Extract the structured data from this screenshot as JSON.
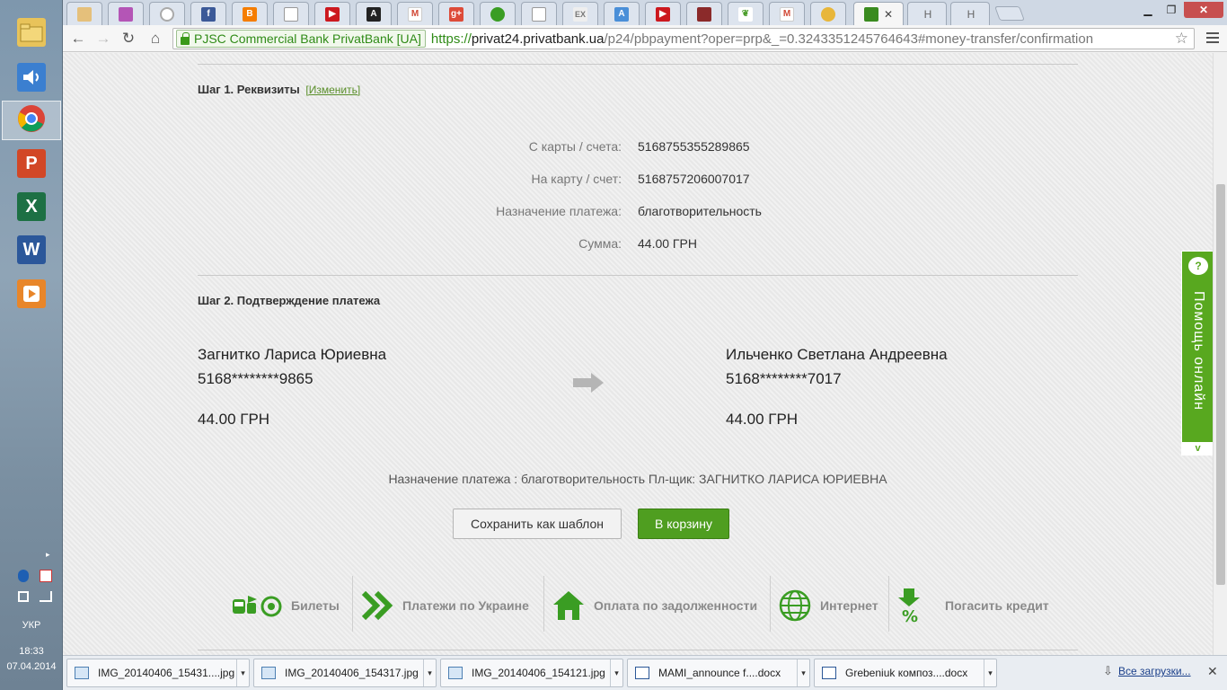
{
  "taskbar": {
    "apps": [
      {
        "name": "file-explorer-icon",
        "label": ""
      },
      {
        "name": "volume-icon",
        "label": ""
      },
      {
        "name": "chrome-icon",
        "label": ""
      },
      {
        "name": "powerpoint-icon",
        "label": "P"
      },
      {
        "name": "excel-icon",
        "label": "X"
      },
      {
        "name": "word-icon",
        "label": "W"
      },
      {
        "name": "media-player-icon",
        "label": ""
      }
    ],
    "language": "УКР",
    "time": "18:33",
    "date": "07.04.2014"
  },
  "browser": {
    "tabs": [
      "",
      "",
      "",
      "",
      "",
      "",
      "",
      "",
      "",
      "",
      "",
      "",
      "",
      "",
      "",
      "",
      "",
      "",
      "",
      "",
      "",
      "",
      "Н",
      "Н"
    ],
    "active_tab_close": "✕",
    "ev_label": "PJSC Commercial Bank PrivatBank [UA]",
    "url": {
      "proto": "https://",
      "host": "privat24.privatbank.ua",
      "path": "/p24/pbpayment?oper=prp&_=0.3243351245764643#money-transfer/confirmation"
    }
  },
  "step1": {
    "title": "Шаг 1. Реквизиты",
    "edit_link": "[Изменить]",
    "rows": [
      {
        "label": "С карты / счета:",
        "value": "5168755355289865"
      },
      {
        "label": "На карту / счет:",
        "value": "5168757206007017"
      },
      {
        "label": "Назначение платежа:",
        "value": "благотворительность"
      },
      {
        "label": "Сумма:",
        "value": "44.00 ГРН"
      }
    ]
  },
  "step2": {
    "title": "Шаг 2. Подтверждение платежа",
    "sender": {
      "name": "Загнитко Лариса Юриевна",
      "card": "5168********9865",
      "amount": "44.00 ГРН"
    },
    "recipient": {
      "name": "Ильченко Светлана Андреевна",
      "card": "5168********7017",
      "amount": "44.00 ГРН"
    },
    "purpose": "Назначение платежа : благотворительность Пл-щик: ЗАГНИТКО ЛАРИСА ЮРИЕВНА",
    "save_template_label": "Сохранить как шаблон",
    "cart_label": "В корзину"
  },
  "services": [
    {
      "name": "tickets",
      "label": "Билеты"
    },
    {
      "name": "ukraine-payments",
      "label": "Платежи по Украине"
    },
    {
      "name": "debt-payment",
      "label": "Оплата по задолженности"
    },
    {
      "name": "internet",
      "label": "Интернет"
    },
    {
      "name": "repay-credit",
      "label": "Погасить кредит"
    }
  ],
  "help_widget": {
    "label": "Помощь онлайн",
    "close": "v"
  },
  "downloads": {
    "items": [
      "IMG_20140406_15431....jpg",
      "IMG_20140406_154317.jpg",
      "IMG_20140406_154121.jpg",
      "MAMI_announce f....docx",
      "Grebeniuk композ....docx"
    ],
    "show_all": "Все загрузки...",
    "close": "✕"
  },
  "colors": {
    "accent_green": "#58a81f",
    "button_green": "#4f9e20",
    "link_green": "#5a8f2a"
  }
}
